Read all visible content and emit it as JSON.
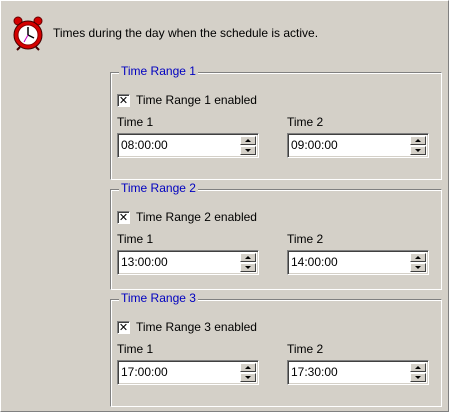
{
  "header": {
    "icon": "alarm-clock-icon",
    "text": "Times during the day when the schedule is active."
  },
  "ranges": [
    {
      "legend": "Time Range 1",
      "enabled_label": "Time Range 1 enabled",
      "enabled": true,
      "time1_label": "Time 1",
      "time1_value": "08:00:00",
      "time2_label": "Time 2",
      "time2_value": "09:00:00"
    },
    {
      "legend": "Time Range 2",
      "enabled_label": "Time Range 2 enabled",
      "enabled": true,
      "time1_label": "Time 1",
      "time1_value": "13:00:00",
      "time2_label": "Time 2",
      "time2_value": "14:00:00"
    },
    {
      "legend": "Time Range 3",
      "enabled_label": "Time Range 3 enabled",
      "enabled": true,
      "time1_label": "Time 1",
      "time1_value": "17:00:00",
      "time2_label": "Time 2",
      "time2_value": "17:30:00"
    }
  ],
  "colors": {
    "background": "#d4d0c8",
    "legend_text": "#0000c0",
    "clock_red": "#d40000"
  }
}
